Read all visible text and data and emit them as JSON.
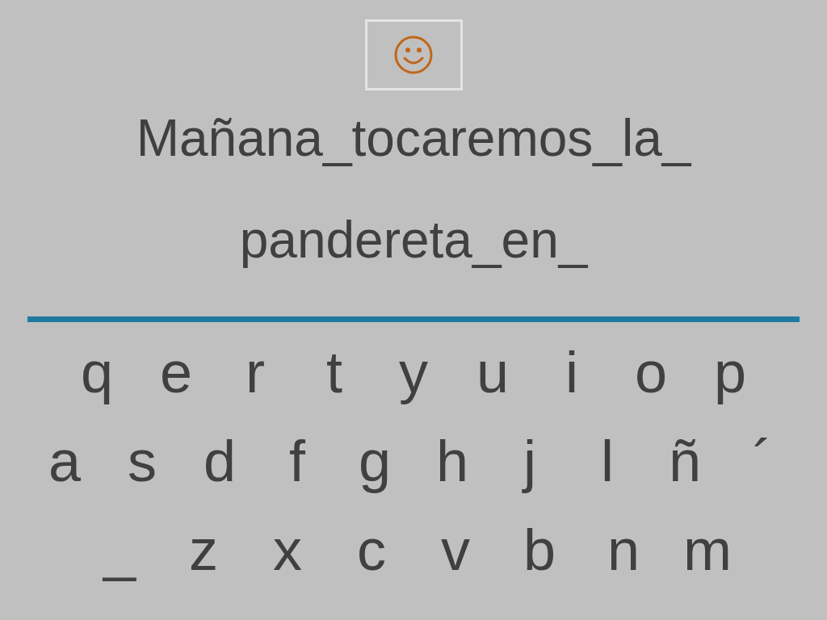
{
  "sentence_lines": [
    "Mañana_tocaremos_la_",
    "pandereta_en_"
  ],
  "keyboard_rows": [
    [
      "q",
      "e",
      "r",
      "t",
      "y",
      "u",
      "i",
      "o",
      "p"
    ],
    [
      "a",
      "s",
      "d",
      "f",
      "g",
      "h",
      "j",
      "l",
      "ñ",
      "´"
    ],
    [
      "_",
      "z",
      "x",
      "c",
      "v",
      "b",
      "n",
      "m"
    ]
  ]
}
